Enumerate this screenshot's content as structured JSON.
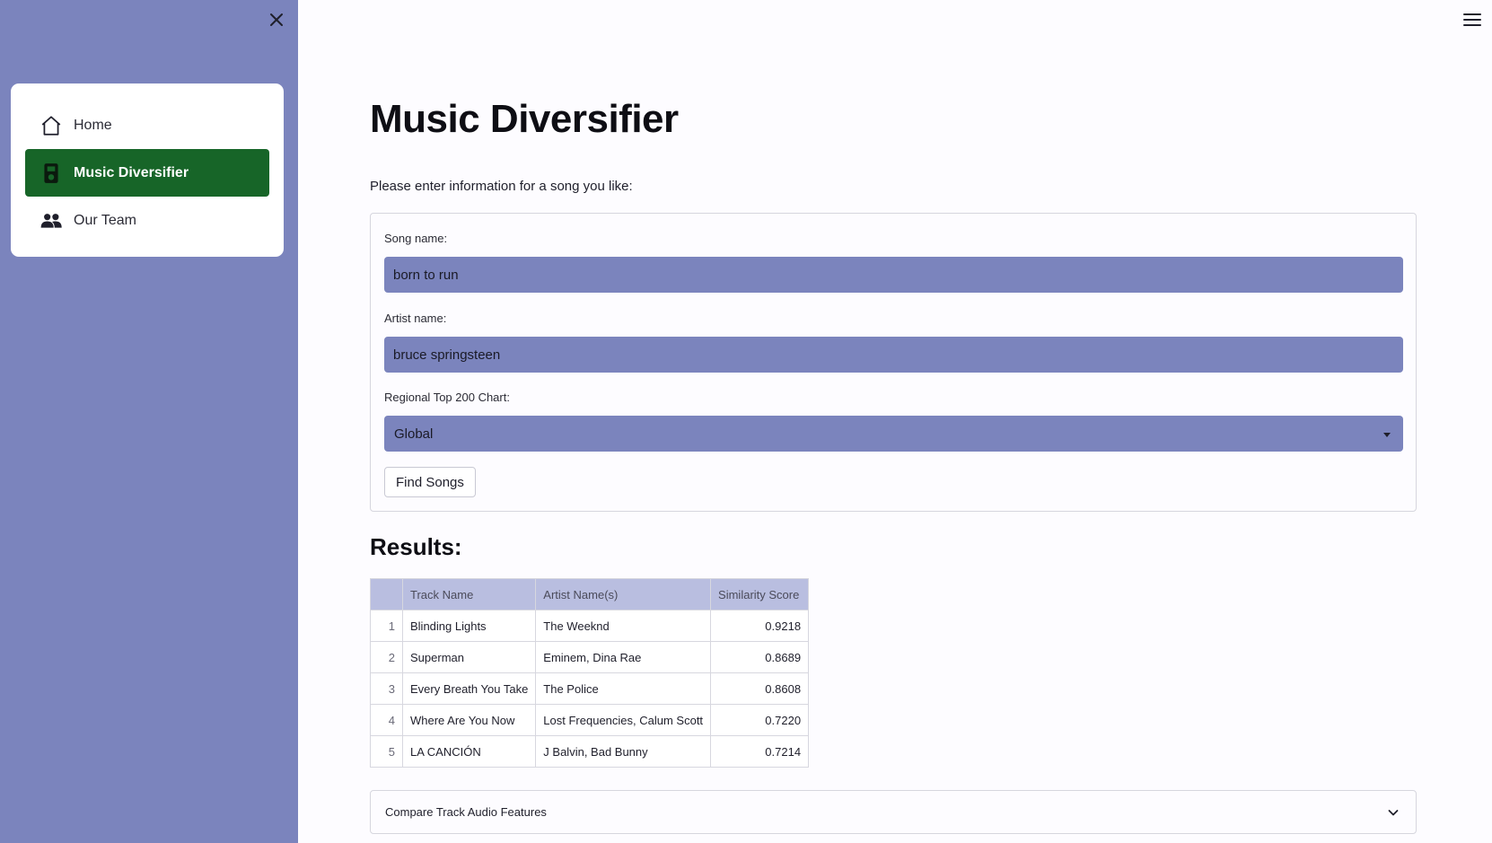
{
  "sidebar": {
    "close_icon": "close-icon",
    "items": [
      {
        "label": "Home",
        "icon": "home-icon",
        "active": false
      },
      {
        "label": "Music Diversifier",
        "icon": "music-player-icon",
        "active": true
      },
      {
        "label": "Our Team",
        "icon": "people-icon",
        "active": false
      }
    ],
    "active_color": "#176528",
    "background_color": "#7b84bd"
  },
  "header": {
    "menu_icon": "hamburger-menu-icon"
  },
  "main": {
    "title": "Music Diversifier",
    "intro": "Please enter information for a song you like:",
    "form": {
      "song_label": "Song name:",
      "song_value": "born to run",
      "artist_label": "Artist name:",
      "artist_value": "bruce springsteen",
      "chart_label": "Regional Top 200 Chart:",
      "chart_value": "Global",
      "submit_label": "Find Songs"
    },
    "results_title": "Results:",
    "table": {
      "columns": [
        "",
        "Track Name",
        "Artist Name(s)",
        "Similarity Score"
      ],
      "rows": [
        {
          "index": "1",
          "track": "Blinding Lights",
          "artist": "The Weeknd",
          "score": "0.9218"
        },
        {
          "index": "2",
          "track": "Superman",
          "artist": "Eminem, Dina Rae",
          "score": "0.8689"
        },
        {
          "index": "3",
          "track": "Every Breath You Take",
          "artist": "The Police",
          "score": "0.8608"
        },
        {
          "index": "4",
          "track": "Where Are You Now",
          "artist": "Lost Frequencies, Calum Scott",
          "score": "0.7220"
        },
        {
          "index": "5",
          "track": "LA CANCIÓN",
          "artist": "J Balvin, Bad Bunny",
          "score": "0.7214"
        }
      ]
    },
    "expander_label": "Compare Track Audio Features"
  }
}
